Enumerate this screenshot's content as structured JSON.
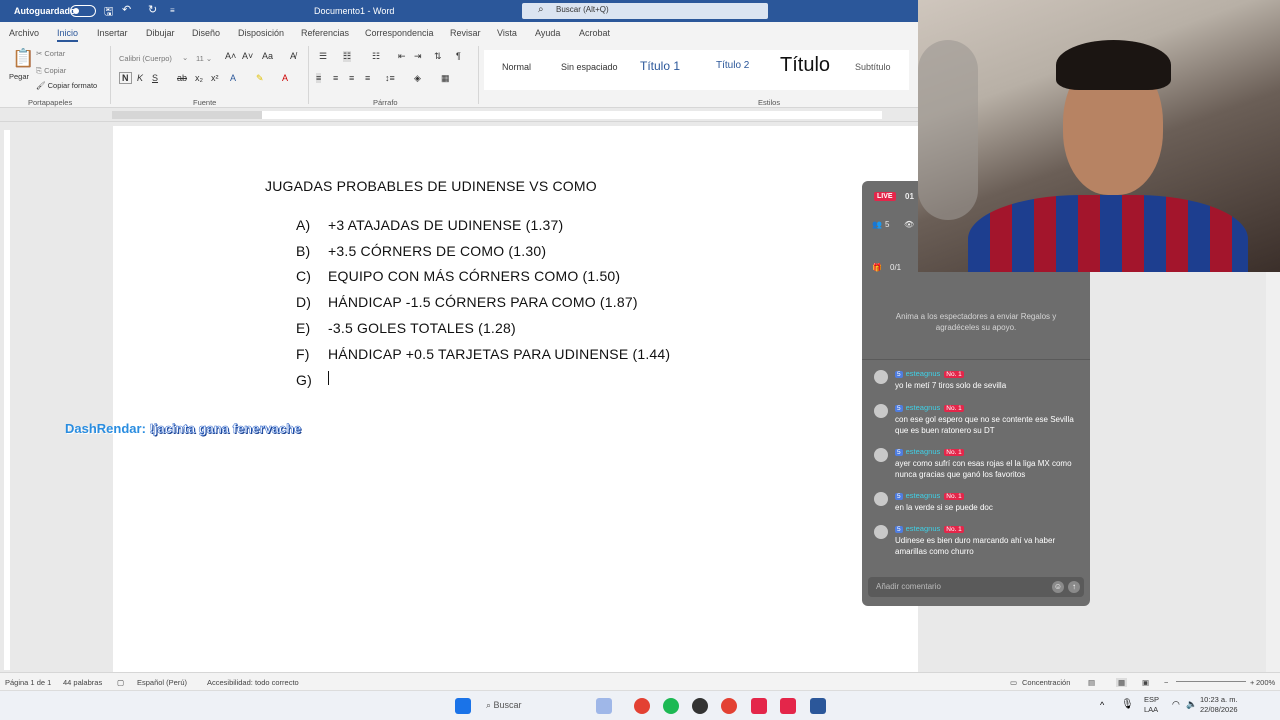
{
  "window": {
    "autosave_label": "Autoguardado",
    "doc_title": "Documento1 - Word",
    "search_placeholder": "Buscar (Alt+Q)"
  },
  "tabs": [
    "Archivo",
    "Inicio",
    "Insertar",
    "Dibujar",
    "Diseño",
    "Disposición",
    "Referencias",
    "Correspondencia",
    "Revisar",
    "Vista",
    "Ayuda",
    "Acrobat"
  ],
  "ribbon": {
    "paste_label": "Pegar",
    "cut_label": "Cortar",
    "copy_label": "Copiar",
    "format_painter_label": "Copiar formato",
    "clipboard_group": "Portapapeles",
    "font_name": "Calibri (Cuerpo)",
    "font_group": "Fuente",
    "paragraph_group": "Párrafo",
    "styles_group": "Estilos",
    "styles": [
      "Normal",
      "Sin espaciado",
      "Título 1",
      "Título 2",
      "Título",
      "Subtítulo"
    ]
  },
  "document": {
    "title": "JUGADAS PROBABLES DE UDINENSE VS COMO",
    "items": [
      {
        "mark": "A)",
        "text": "+3 ATAJADAS DE UDINENSE (1.37)"
      },
      {
        "mark": "B)",
        "text": "+3.5 CÓRNERS DE COMO (1.30)"
      },
      {
        "mark": "C)",
        "text": "EQUIPO CON MÁS CÓRNERS COMO (1.50)"
      },
      {
        "mark": "D)",
        "text": "HÁNDICAP -1.5 CÓRNERS PARA COMO (1.87)"
      },
      {
        "mark": "E)",
        "text": "-3.5 GOLES TOTALES (1.28)"
      },
      {
        "mark": "F)",
        "text": "HÁNDICAP +0.5 TARJETAS PARA UDINENSE (1.44)"
      },
      {
        "mark": "G)",
        "text": ""
      }
    ]
  },
  "overlay": {
    "name": "DashRendar:",
    "message": "!jacinta gana fenervache"
  },
  "live": {
    "badge": "LIVE",
    "timer": "01",
    "viewers": "5",
    "gifts": "0/1",
    "prompt": "Anima a los espectadores a enviar Regalos y agradéceles su apoyo.",
    "comment_placeholder": "Añadir comentario",
    "messages": [
      {
        "level": "5",
        "user": "esteagnus",
        "fan": "No. 1",
        "text": "yo le metí 7 tiros solo de sevilla"
      },
      {
        "level": "5",
        "user": "esteagnus",
        "fan": "No. 1",
        "text": "con ese gol espero que no se contente ese Sevilla que es buen ratonero su DT"
      },
      {
        "level": "5",
        "user": "esteagnus",
        "fan": "No. 1",
        "text": "ayer como sufrí con esas rojas el la liga MX como nunca gracias que ganó los favoritos"
      },
      {
        "level": "5",
        "user": "esteagnus",
        "fan": "No. 1",
        "text": "en la verde si se puede doc"
      },
      {
        "level": "5",
        "user": "esteagnus",
        "fan": "No. 1",
        "text": "Udinese es bien duro marcando ahí va haber amarillas como churro"
      }
    ]
  },
  "status": {
    "page": "Página 1 de 1",
    "words": "44 palabras",
    "language": "Español (Perú)",
    "accessibility": "Accesibilidad: todo correcto",
    "focus": "Concentración",
    "zoom": "200%"
  },
  "taskbar": {
    "search": "Buscar",
    "lang_1": "ESP",
    "lang_2": "LAA",
    "time": "10:23 a. m.",
    "date": "22/08/2026"
  },
  "colors": {
    "word_blue": "#2b579a",
    "live_red": "#e4264a",
    "username_cyan": "#3fd0e6"
  }
}
